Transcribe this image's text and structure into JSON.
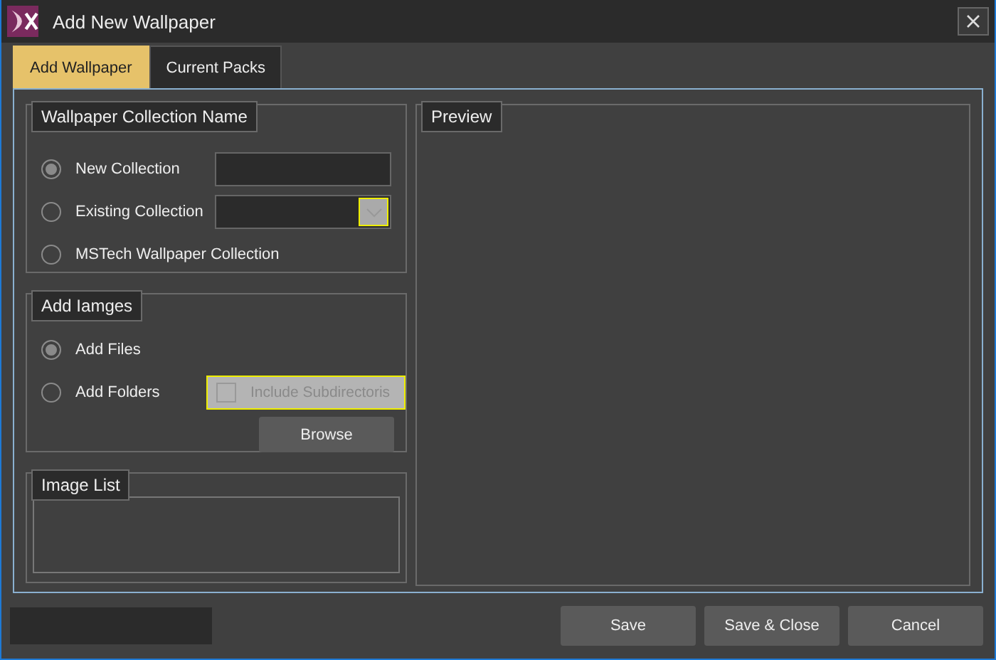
{
  "window": {
    "title": "Add New Wallpaper"
  },
  "tabs": [
    {
      "label": "Add Wallpaper",
      "selected": true
    },
    {
      "label": "Current Packs",
      "selected": false
    }
  ],
  "collection_group": {
    "title": "Wallpaper Collection Name",
    "options": [
      {
        "label": "New Collection",
        "selected": true,
        "kind": "text"
      },
      {
        "label": "Existing Collection",
        "selected": false,
        "kind": "dropdown"
      },
      {
        "label": "MSTech Wallpaper Collection",
        "selected": false,
        "kind": "plain"
      }
    ]
  },
  "images_group": {
    "title": "Add Iamges",
    "options": [
      {
        "label": "Add Files",
        "selected": true,
        "kind": "plain"
      },
      {
        "label": "Add Folders",
        "selected": false,
        "kind": "folders"
      }
    ],
    "include_subdirectories": {
      "label": "Include Subdirectoris",
      "checked": false,
      "disabled": true
    },
    "browse_button": "Browse"
  },
  "image_list_group": {
    "title": "Image List"
  },
  "preview_group": {
    "title": "Preview"
  },
  "buttons": [
    "Save",
    "Save & Close",
    "Cancel"
  ]
}
